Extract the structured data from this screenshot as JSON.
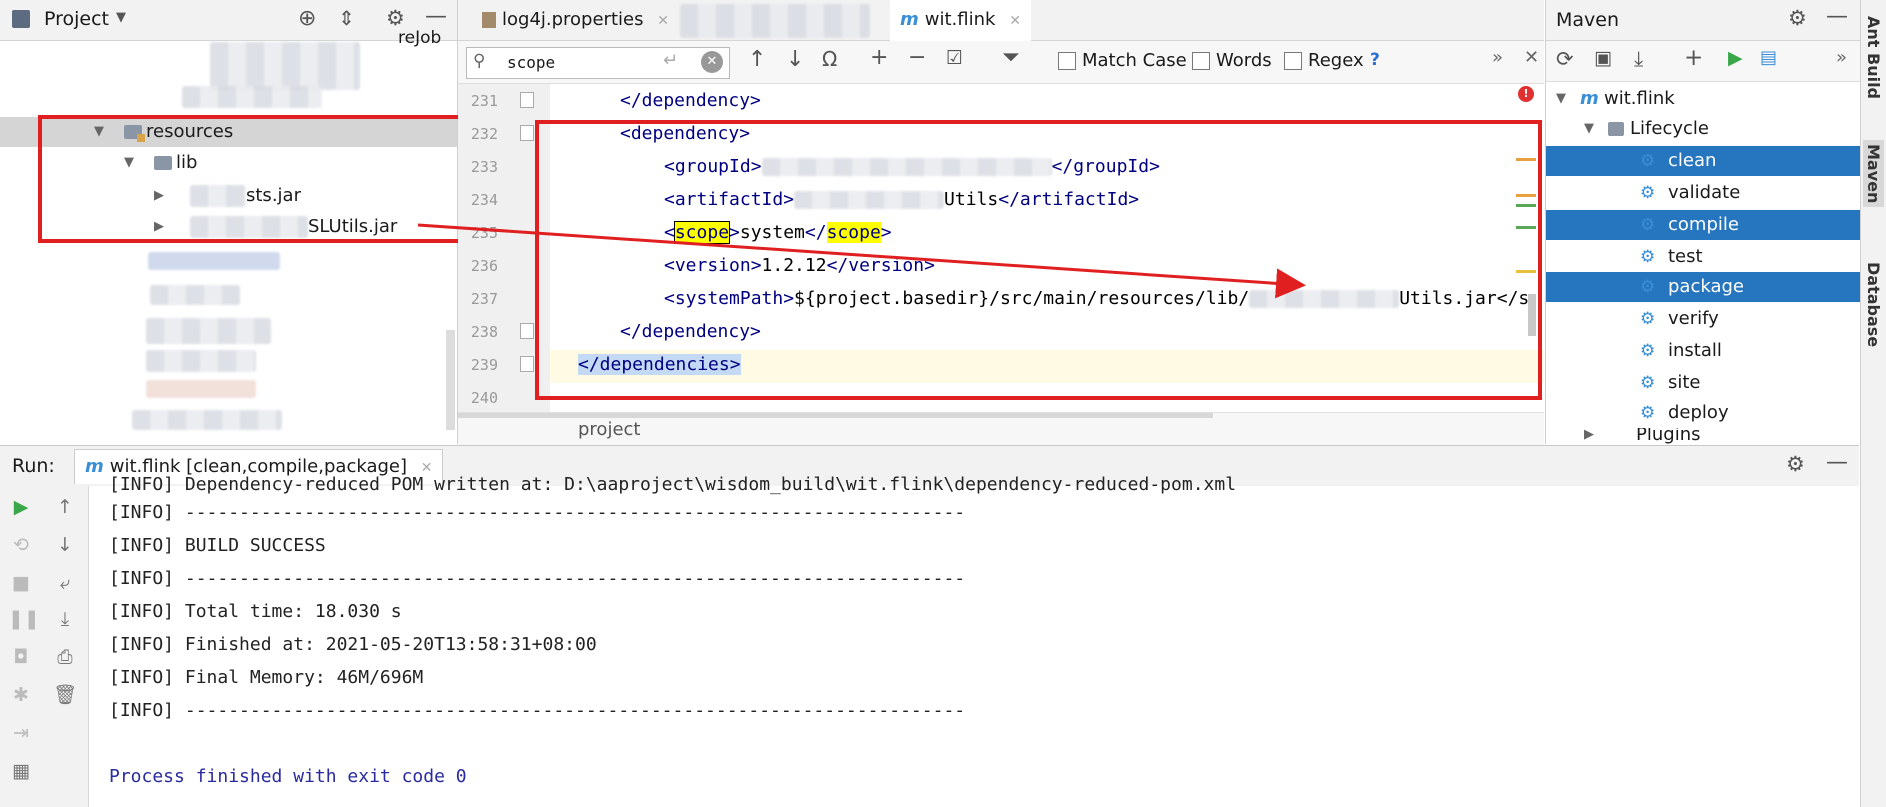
{
  "project": {
    "title": "Project",
    "top_partial": "reJob",
    "resources_label": "resources",
    "lib_label": "lib",
    "jar1": "sts.jar",
    "jar2": "SLUtils.jar"
  },
  "tabs": [
    {
      "label": "log4j.properties",
      "icon": "properties-file-icon"
    },
    {
      "label": "",
      "icon": ""
    },
    {
      "label": "wit.flink",
      "icon": "maven-m-icon",
      "active": true
    }
  ],
  "search": {
    "query": "scope",
    "match_case": "Match Case",
    "words": "Words",
    "regex": "Regex",
    "help": "?"
  },
  "editor": {
    "lines": [
      {
        "no": "231",
        "parts": [
          [
            "tag",
            "</"
          ],
          [
            "tag",
            "dependency"
          ],
          [
            "tag",
            ">"
          ]
        ],
        "indent": 1
      },
      {
        "no": "232",
        "parts": [
          [
            "tag",
            "<"
          ],
          [
            "tag",
            "dependency"
          ],
          [
            "tag",
            ">"
          ]
        ],
        "indent": 1
      },
      {
        "no": "233",
        "text": "groupId",
        "indent": 2
      },
      {
        "no": "234",
        "text": "artifactId",
        "indent": 2
      },
      {
        "no": "235",
        "text": "scope",
        "indent": 2
      },
      {
        "no": "236",
        "text": "version",
        "indent": 2
      },
      {
        "no": "237",
        "text": "systemPath",
        "indent": 2
      },
      {
        "no": "238",
        "text": "dependency-close",
        "indent": 1
      },
      {
        "no": "239",
        "text": "dependencies-close",
        "indent": 0
      },
      {
        "no": "240",
        "text": "",
        "indent": 0
      }
    ],
    "version_value": "1.2.12",
    "scope_value": "system",
    "system_path_prefix": "${project.basedir}/src/main/resources/lib/",
    "system_path_suffix": "Utils.jar</s",
    "artifact_suffix": "Utils",
    "breadcrumb": "project"
  },
  "maven": {
    "title": "Maven",
    "root": "wit.flink",
    "lifecycle": "Lifecycle",
    "goals": [
      "clean",
      "validate",
      "compile",
      "test",
      "package",
      "verify",
      "install",
      "site",
      "deploy"
    ],
    "selected": [
      "clean",
      "compile",
      "package"
    ],
    "plugins": "Plugins",
    "side_tabs": [
      "Ant Build",
      "Maven",
      "Database"
    ]
  },
  "run": {
    "label": "Run:",
    "tab": "wit.flink [clean,compile,package]",
    "lines": [
      "[INFO] Dependency-reduced POM written at: D:\\aaproject\\wisdom_build\\wit.flink\\dependency-reduced-pom.xml",
      "[INFO] ------------------------------------------------------------------------",
      "[INFO] BUILD SUCCESS",
      "[INFO] ------------------------------------------------------------------------",
      "[INFO] Total time: 18.030 s",
      "[INFO] Finished at: 2021-05-20T13:58:31+08:00",
      "[INFO] Final Memory: 46M/696M",
      "[INFO] ------------------------------------------------------------------------",
      "",
      "Process finished with exit code 0"
    ]
  },
  "colors": {
    "selection": "#2675bf",
    "annotation": "#e02020",
    "tag": "#000080",
    "highlight": "#ffff00"
  }
}
